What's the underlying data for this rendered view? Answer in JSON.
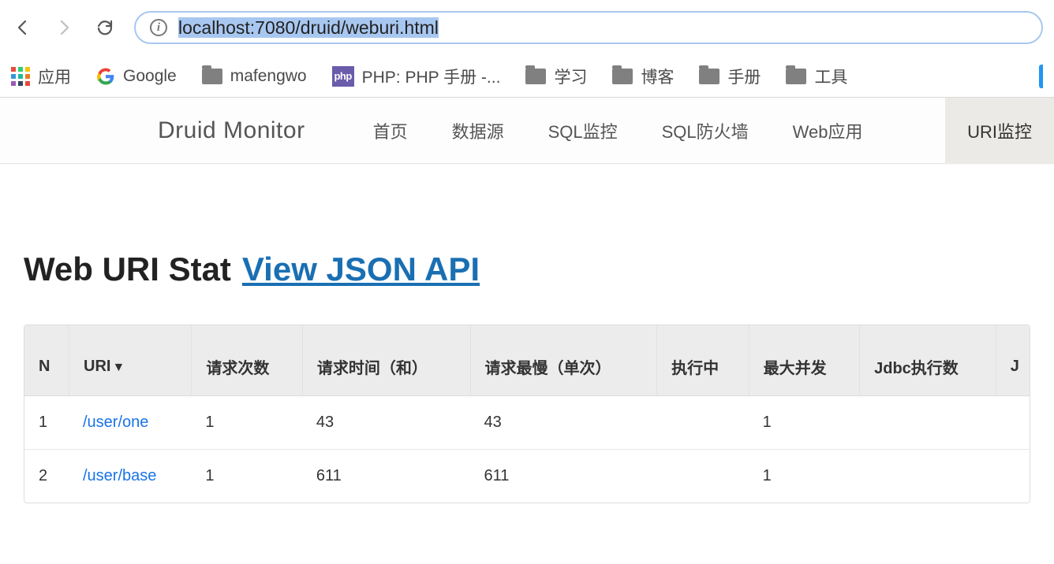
{
  "browser": {
    "url_display": "localhost:7080/druid/weburi.html",
    "bookmarks": {
      "apps_label": "应用",
      "google": "Google",
      "mafengwo": "mafengwo",
      "php_manual": "PHP: PHP 手册 -...",
      "study": "学习",
      "blog": "博客",
      "manual": "手册",
      "tools": "工具"
    }
  },
  "navbar": {
    "brand": "Druid Monitor",
    "items": {
      "home": "首页",
      "datasource": "数据源",
      "sql_monitor": "SQL监控",
      "sql_firewall": "SQL防火墙",
      "web_app": "Web应用",
      "uri_monitor": "URI监控"
    },
    "active": "uri_monitor"
  },
  "page": {
    "title_prefix": "Web URI Stat",
    "view_json_label": "View JSON API"
  },
  "table": {
    "headers": {
      "n": "N",
      "uri": "URI",
      "sort_indicator": "▼",
      "req_count": "请求次数",
      "req_time_sum": "请求时间（和）",
      "req_slowest": "请求最慢（单次）",
      "running": "执行中",
      "max_concurrent": "最大并发",
      "jdbc_exec": "Jdbc执行数",
      "jdbc_partial": "J"
    },
    "rows": [
      {
        "n": "1",
        "uri": "/user/one",
        "req_count": "1",
        "req_time_sum": "43",
        "req_slowest": "43",
        "running": "",
        "max_concurrent": "1",
        "jdbc_exec": ""
      },
      {
        "n": "2",
        "uri": "/user/base",
        "req_count": "1",
        "req_time_sum": "611",
        "req_slowest": "611",
        "running": "",
        "max_concurrent": "1",
        "jdbc_exec": ""
      }
    ]
  }
}
